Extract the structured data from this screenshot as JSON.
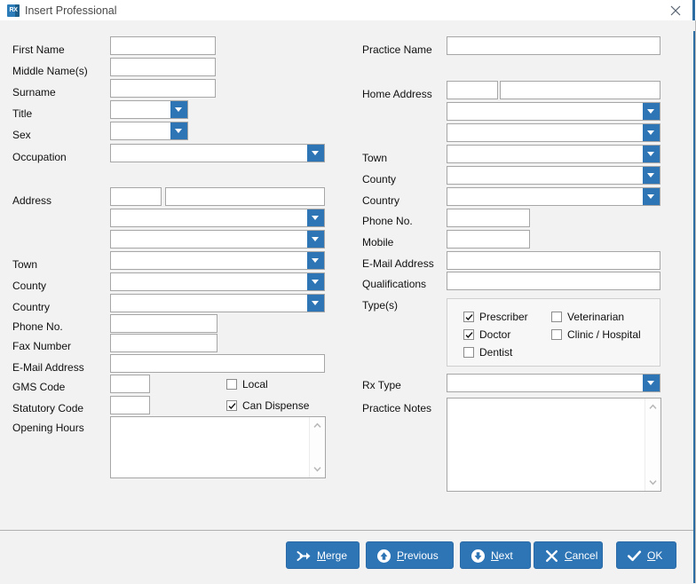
{
  "window": {
    "title": "Insert Professional",
    "icon": "rx-app-icon",
    "icon_text": "RX",
    "close_icon": "close-icon",
    "accent_color": "#2e75b6",
    "titlebar_bg": "#ffffff",
    "body_bg": "#f2f2f2"
  },
  "left_column": {
    "first_name": {
      "label": "First Name",
      "value": "",
      "placeholder": ""
    },
    "middle_names": {
      "label": "Middle Name(s)",
      "value": "",
      "placeholder": ""
    },
    "surname": {
      "label": "Surname",
      "value": "",
      "placeholder": ""
    },
    "title": {
      "label": "Title",
      "value": ""
    },
    "sex": {
      "label": "Sex",
      "value": ""
    },
    "occupation": {
      "label": "Occupation",
      "value": ""
    },
    "address": {
      "label": "Address",
      "number_value": "",
      "street_value": "",
      "line2_value": "",
      "line3_value": ""
    },
    "town": {
      "label": "Town",
      "value": ""
    },
    "county": {
      "label": "County",
      "value": ""
    },
    "country": {
      "label": "Country",
      "value": ""
    },
    "phone_no": {
      "label": "Phone No.",
      "value": ""
    },
    "fax_number": {
      "label": "Fax Number",
      "value": ""
    },
    "email_address": {
      "label": "E-Mail Address",
      "value": ""
    },
    "gms_code": {
      "label": "GMS Code",
      "value": ""
    },
    "statutory_code": {
      "label": "Statutory Code",
      "value": ""
    },
    "opening_hours": {
      "label": "Opening Hours",
      "value": ""
    },
    "local": {
      "label": "Local",
      "checked": false
    },
    "can_dispense": {
      "label": "Can Dispense",
      "checked": true
    }
  },
  "right_column": {
    "practice_name": {
      "label": "Practice Name",
      "value": ""
    },
    "home_address": {
      "label": "Home Address",
      "number_value": "",
      "street_value": "",
      "line2_value": "",
      "line3_value": ""
    },
    "town": {
      "label": "Town",
      "value": ""
    },
    "county": {
      "label": "County",
      "value": ""
    },
    "country": {
      "label": "Country",
      "value": ""
    },
    "phone_no": {
      "label": "Phone No.",
      "value": ""
    },
    "mobile": {
      "label": "Mobile",
      "value": ""
    },
    "email_address": {
      "label": "E-Mail Address",
      "value": ""
    },
    "qualifications": {
      "label": "Qualifications",
      "value": ""
    },
    "types": {
      "label": "Type(s)",
      "options": [
        {
          "label": "Prescriber",
          "checked": true
        },
        {
          "label": "Doctor",
          "checked": true
        },
        {
          "label": "Dentist",
          "checked": false
        },
        {
          "label": "Veterinarian",
          "checked": false
        },
        {
          "label": "Clinic / Hospital",
          "checked": false
        }
      ]
    },
    "rx_type": {
      "label": "Rx Type",
      "value": ""
    },
    "practice_notes": {
      "label": "Practice Notes",
      "value": ""
    }
  },
  "footer": {
    "buttons": [
      {
        "label": "Merge",
        "mnemonic": "M",
        "icon": "merge-arrow-icon"
      },
      {
        "label": "Previous",
        "mnemonic": "P",
        "icon": "circle-up-arrow-icon"
      },
      {
        "label": "Next",
        "mnemonic": "N",
        "icon": "circle-down-arrow-icon"
      },
      {
        "label": "Cancel",
        "mnemonic": "C",
        "icon": "x-cross-icon"
      },
      {
        "label": "OK",
        "mnemonic": "O",
        "icon": "checkmark-icon"
      }
    ]
  }
}
